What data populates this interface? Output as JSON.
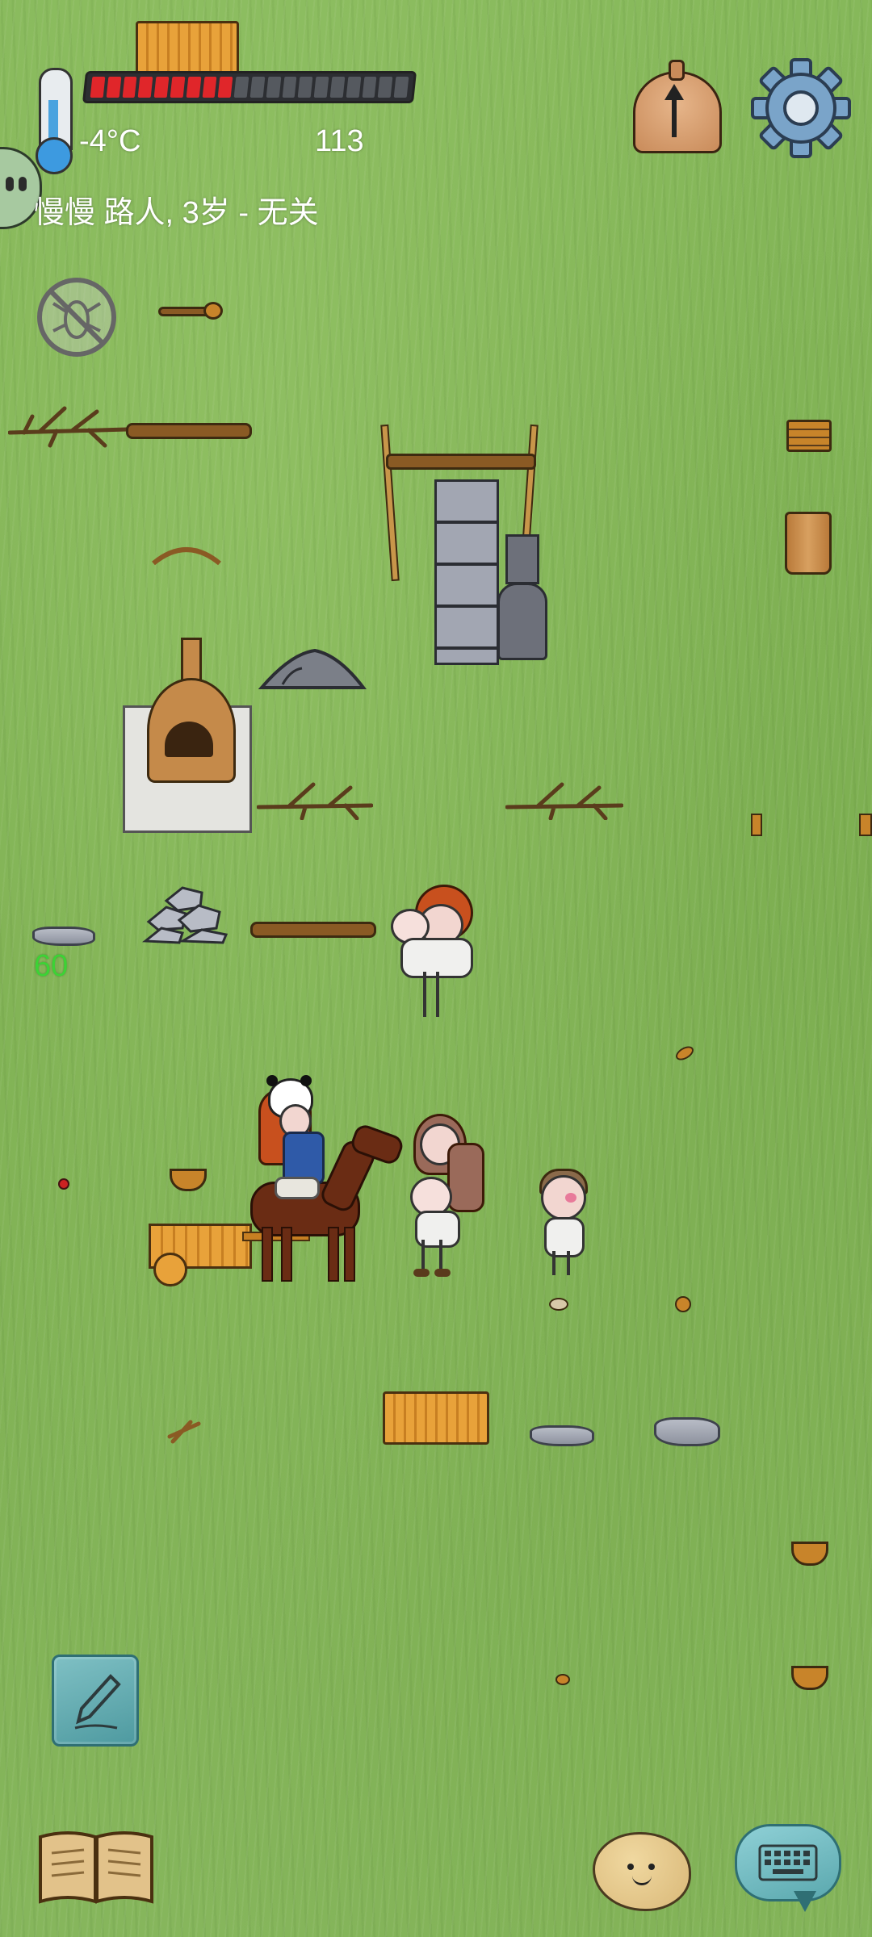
{
  "hud": {
    "temperature": "-4°C",
    "food_counter": "113",
    "status_line": "慢慢 路人, 3岁 - 无关",
    "food_bar_filled": 9,
    "food_bar_total": 20,
    "food_bar_fill_color": "#e0262a",
    "food_bar_empty_color": "#55595f"
  },
  "world": {
    "floating_number": "60",
    "floating_number_color": "#3cd335"
  },
  "icons": {
    "thermometer": "thermometer-icon",
    "compass": "compass-icon",
    "settings": "gear-icon",
    "no_bugs": "no-insects-icon",
    "note": "pencil-note-icon",
    "tech_book": "open-book-icon",
    "emote": "potato-emote-icon",
    "keyboard": "keyboard-chat-icon",
    "side_tab": "side-face-tab-icon"
  }
}
